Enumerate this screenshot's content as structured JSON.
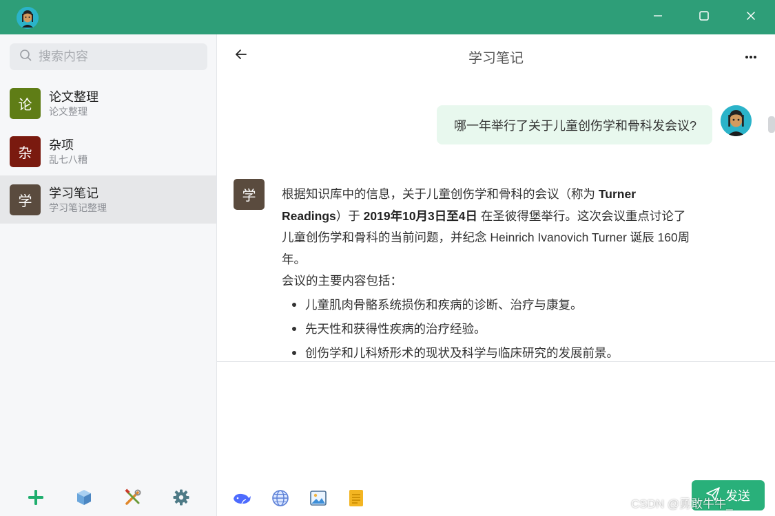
{
  "colors": {
    "titlebar": "#2e9e78",
    "accent": "#29b07a",
    "user_bubble": "#e8f8ee",
    "badge_lunwen": "#5f7d16",
    "badge_zaxiang": "#7a1a0f",
    "badge_xuexi": "#5a4b3e"
  },
  "titlebar": {
    "icons": [
      "app-avatar",
      "minimize-icon",
      "maximize-icon",
      "close-icon"
    ]
  },
  "sidebar": {
    "search_placeholder": "搜索内容",
    "conversations": [
      {
        "badge": "论",
        "title": "论文整理",
        "subtitle": "论文整理",
        "active": false
      },
      {
        "badge": "杂",
        "title": "杂项",
        "subtitle": "乱七八糟",
        "active": false
      },
      {
        "badge": "学",
        "title": "学习笔记",
        "subtitle": "学习笔记整理",
        "active": true
      }
    ],
    "footer_icons": [
      "add-icon",
      "cube-icon",
      "tools-icon",
      "settings-gear-icon"
    ]
  },
  "chat": {
    "title": "学习笔记",
    "user_message": "哪一年举行了关于儿童创伤学和骨科发会议?",
    "bot_badge": "学",
    "bot_message": {
      "p1_a": "根据知识库中的信息，关于儿童创伤学和骨科的会议（称为 ",
      "p1_bold1": "Turner Readings",
      "p1_b": "）于 ",
      "p1_bold2": "2019年10月3日至4日",
      "p1_c": " 在圣彼得堡举行。这次会议重点讨论了儿童创伤学和骨科的当前问题，并纪念 Heinrich Ivanovich Turner 诞辰 160周年。",
      "p2": "会议的主要内容包括：",
      "bullets": [
        "儿童肌肉骨骼系统损伤和疾病的诊断、治疗与康复。",
        "先天性和获得性疾病的治疗经验。",
        "创伤学和儿科矫形术的现状及科学与临床研究的发展前景。"
      ]
    }
  },
  "composer": {
    "tool_icons": [
      "whale-model-icon",
      "globe-web-icon",
      "image-icon",
      "document-icon"
    ],
    "send_label": "发送"
  },
  "watermark": "CSDN @勇敢牛牛_"
}
